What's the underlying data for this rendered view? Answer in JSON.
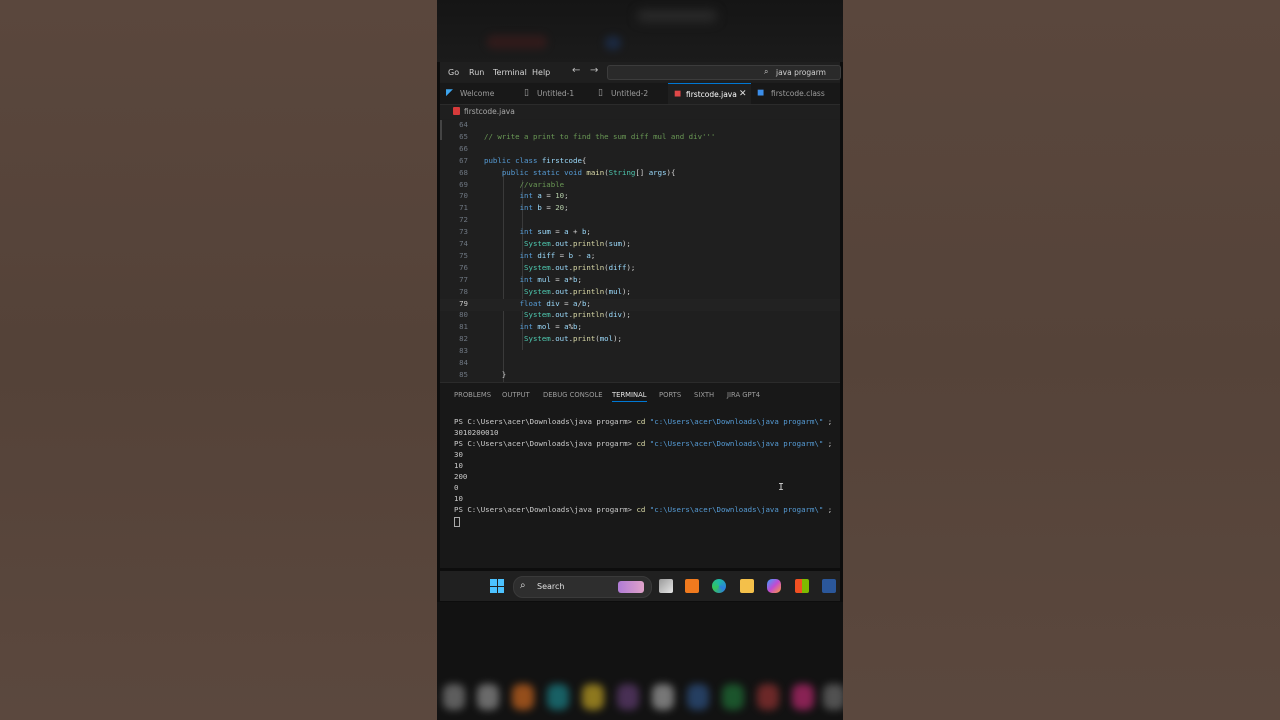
{
  "menu": {
    "items": [
      "Go",
      "Run",
      "Terminal",
      "Help"
    ]
  },
  "search": {
    "value": "java progarm"
  },
  "tabs": [
    {
      "label": "Welcome",
      "icon": "vscode-icon",
      "active": false
    },
    {
      "label": "Untitled-1",
      "icon": "file-icon",
      "active": false
    },
    {
      "label": "Untitled-2",
      "icon": "file-icon",
      "active": false
    },
    {
      "label": "firstcode.java",
      "icon": "java-icon",
      "active": true
    },
    {
      "label": "firstcode.class",
      "icon": "class-file-icon",
      "active": false
    }
  ],
  "breadcrumb": {
    "file": "firstcode.java"
  },
  "editor": {
    "current_line": 79,
    "lines": [
      {
        "n": "64",
        "text": ""
      },
      {
        "n": "65",
        "text": "// write a print to find the sum diff mul and div'''"
      },
      {
        "n": "66",
        "text": ""
      },
      {
        "n": "67",
        "text": "public class firstcode{"
      },
      {
        "n": "68",
        "text": "    public static void main(String[] args){"
      },
      {
        "n": "69",
        "text": "        //variable"
      },
      {
        "n": "70",
        "text": "        int a = 10;"
      },
      {
        "n": "71",
        "text": "        int b = 20;"
      },
      {
        "n": "72",
        "text": ""
      },
      {
        "n": "73",
        "text": "        int sum = a + b;"
      },
      {
        "n": "74",
        "text": "         System.out.println(sum);"
      },
      {
        "n": "75",
        "text": "        int diff = b - a;"
      },
      {
        "n": "76",
        "text": "         System.out.println(diff);"
      },
      {
        "n": "77",
        "text": "        int mul = a*b;"
      },
      {
        "n": "78",
        "text": "         System.out.println(mul);"
      },
      {
        "n": "79",
        "text": "        float div = a/b;"
      },
      {
        "n": "80",
        "text": "         System.out.println(div);"
      },
      {
        "n": "81",
        "text": "        int mol = a%b;"
      },
      {
        "n": "82",
        "text": "         System.out.print(mol);"
      },
      {
        "n": "83",
        "text": ""
      },
      {
        "n": "84",
        "text": ""
      },
      {
        "n": "85",
        "text": "    }"
      }
    ]
  },
  "panel": {
    "tabs": [
      "PROBLEMS",
      "OUTPUT",
      "DEBUG CONSOLE",
      "TERMINAL",
      "PORTS",
      "SIXTH",
      "JIRA GPT4"
    ],
    "active_tab": "TERMINAL"
  },
  "terminal": {
    "prompt": "PS C:\\Users\\acer\\Downloads\\java progarm>",
    "cmd": "cd",
    "path_arg": "\"c:\\Users\\acer\\Downloads\\java progarm\\\"",
    "tail": ";",
    "output1": "3010200010",
    "outputs": [
      "30",
      "10",
      "200",
      "0",
      "10"
    ]
  },
  "taskbar": {
    "search_label": "Search",
    "apps": [
      "file-explorer-icon",
      "vlc-icon",
      "edge-icon",
      "folder-icon",
      "copilot-icon",
      "store-icon",
      "word-icon"
    ]
  }
}
